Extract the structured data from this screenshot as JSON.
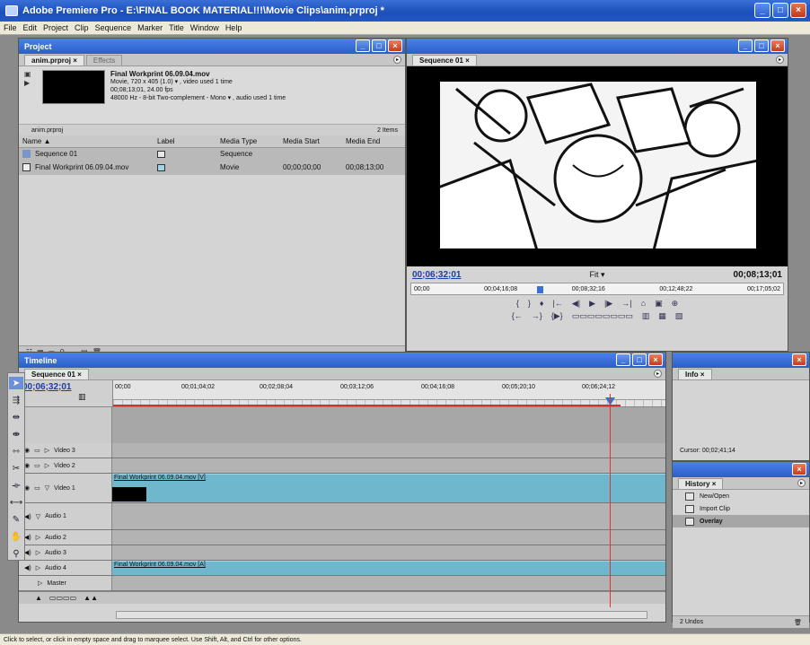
{
  "window": {
    "title": "Adobe Premiere Pro - E:\\FINAL BOOK MATERIAL!!!\\Movie Clips\\anim.prproj *",
    "minimize": "_",
    "maximize": "□",
    "close": "×"
  },
  "menu": [
    "File",
    "Edit",
    "Project",
    "Clip",
    "Sequence",
    "Marker",
    "Title",
    "Window",
    "Help"
  ],
  "project": {
    "title": "Project",
    "tabs": [
      "anim.prproj ×",
      "Effects"
    ],
    "clip_name": "Final Workprint 06.09.04.mov",
    "clip_line1": "Movie, 720 x 405 (1.0)  ▾  , video used 1 time",
    "clip_line2": "00;08;13;01, 24.00 fps",
    "clip_line3": "48000 Hz - 8-bit Two-complement - Mono  ▾  , audio used 1 time",
    "bin_name": "anim.prproj",
    "item_count": "2 Items",
    "columns": [
      "Name  ▲",
      "Label",
      "Media Type",
      "Media Start",
      "Media End"
    ],
    "rows": [
      {
        "name": "Sequence 01",
        "media_type": "Sequence",
        "start": "",
        "end": "",
        "label_color": "#e8e8e8"
      },
      {
        "name": "Final Workprint 06.09.04.mov",
        "media_type": "Movie",
        "start": "00;00;00;00",
        "end": "00;08;13;00",
        "label_color": "#9fd3e6"
      }
    ]
  },
  "monitor": {
    "tab": "Sequence 01 ×",
    "current_time": "00;06;32;01",
    "fit": "Fit",
    "duration": "00;08;13;01",
    "ruler": [
      "00;00",
      "00;04;16;08",
      "00;08;32;16",
      "00;12;48;22",
      "00;17;05;02"
    ]
  },
  "timeline": {
    "title": "Timeline",
    "tab": "Sequence 01 ×",
    "current_time": "00;06;32;01",
    "ruler": [
      "00;00",
      "00;01;04;02",
      "00;02;08;04",
      "00;03;12;06",
      "00;04;16;08",
      "00;05;20;10",
      "00;06;24;12"
    ],
    "tracks": [
      {
        "name": "Video 3",
        "clip": ""
      },
      {
        "name": "Video 2",
        "clip": ""
      },
      {
        "name": "Video 1",
        "clip": "Final Workprint 06.09.04.mov [V]"
      },
      {
        "name": "Audio 1",
        "clip": ""
      },
      {
        "name": "Audio 2",
        "clip": ""
      },
      {
        "name": "Audio 3",
        "clip": ""
      },
      {
        "name": "Audio 4",
        "clip": "Final Workprint 06.09.04.mov [A]"
      },
      {
        "name": "Master",
        "clip": ""
      }
    ]
  },
  "info": {
    "tab": "Info ×",
    "cursor": "Cursor: 00;02;41;14"
  },
  "history": {
    "tab": "History ×",
    "items": [
      "New/Open",
      "Import Clip",
      "Overlay"
    ],
    "undo": "2 Undos"
  },
  "status": "Click to select, or click in empty space and drag to marquee select. Use Shift, Alt, and Ctrl for other options.",
  "colors": {
    "titlebar": "#2358c6",
    "panel": "#d4d4d4",
    "clip": "#6fb7cc",
    "timecode": "#1b3fa6",
    "playhead": "#dd3333"
  }
}
